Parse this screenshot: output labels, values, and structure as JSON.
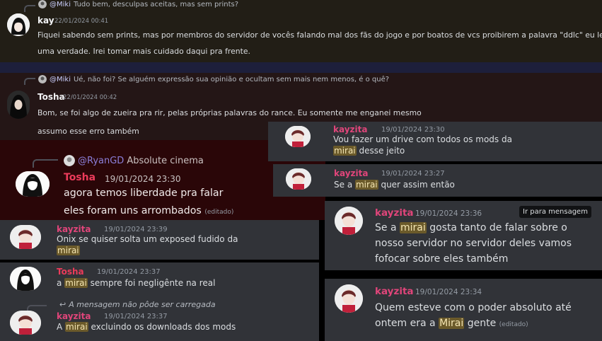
{
  "panel1": {
    "reply": {
      "mention": "@Miki",
      "text": "Tudo bem, desculpas aceitas, mas sem prints?"
    },
    "author": "kay",
    "timestamp": "22/01/2024 00:41",
    "line1": "Fiquei sabendo sem prints, mas por membros do servidor de vocês falando mal dos fãs do jogo e por boatos de vcs proibirem a palavra \"ddlc\" eu levei como",
    "line2": "uma verdade. Irei tomar mais cuidado daqui pra frente."
  },
  "panel2": {
    "reply": {
      "mention": "@Miki",
      "text": "Ué, não foi? Se alguém expressão sua opinião e ocultam sem mais nem menos, é o quê?"
    },
    "author": "Tosha",
    "timestamp": "22/01/2024 00:42",
    "line1": "Bom, se foi algo de zueira pra rir, pelas próprias palavras do rance. Eu somente me enganei mesmo",
    "line2": "assumo esse erro também"
  },
  "panel3": {
    "reply": {
      "mention": "@RyanGD",
      "text": "Absolute cinema"
    },
    "author": "Tosha",
    "timestamp": "19/01/2024 23:30",
    "line1": "agora temos liberdade pra falar",
    "line2": "eles foram uns arrombados",
    "edited": "(editado)"
  },
  "panel4": {
    "author": "kayzita",
    "timestamp": "19/01/2024 23:30",
    "line1": "Vou fazer um drive com todos os mods da",
    "highlight": "mirai",
    "line2_rest": " desse jeito"
  },
  "panel5": {
    "author": "kayzita",
    "timestamp": "19/01/2024 23:27",
    "pre": "Se a ",
    "highlight": "mirai",
    "post": " quer assim então"
  },
  "panel6": {
    "author": "kayzita",
    "timestamp": "19/01/2024 23:36",
    "tooltip": "Ir para mensagem",
    "pre": "Se a ",
    "highlight": "mirai",
    "post": " gosta tanto de falar sobre o",
    "line2": "nosso servidor no servidor deles vamos",
    "line3": "fofocar sobre eles também"
  },
  "panel7": {
    "author": "kayzita",
    "timestamp": "19/01/2024 23:39",
    "line1": "Onix se quiser solta um exposed fudido da",
    "highlight": "mirai"
  },
  "panel8": {
    "author": "Tosha",
    "timestamp": "19/01/2024 23:37",
    "pre": "a ",
    "highlight": "mirai",
    "post": " sempre foi negligênte na real"
  },
  "panel9": {
    "reply": {
      "text": "A mensagem não pôde ser carregada"
    },
    "author": "kayzita",
    "timestamp": "19/01/2024 23:37",
    "pre": "A ",
    "highlight": "mirai",
    "post": " excluindo os downloads dos mods"
  },
  "panel10": {
    "author": "kayzita",
    "timestamp": "19/01/2024 23:34",
    "line1": "Quem esteve com o poder absoluto até",
    "pre": "ontem era a ",
    "highlight": "Mirai",
    "post": " gente",
    "edited": "(editado)"
  }
}
